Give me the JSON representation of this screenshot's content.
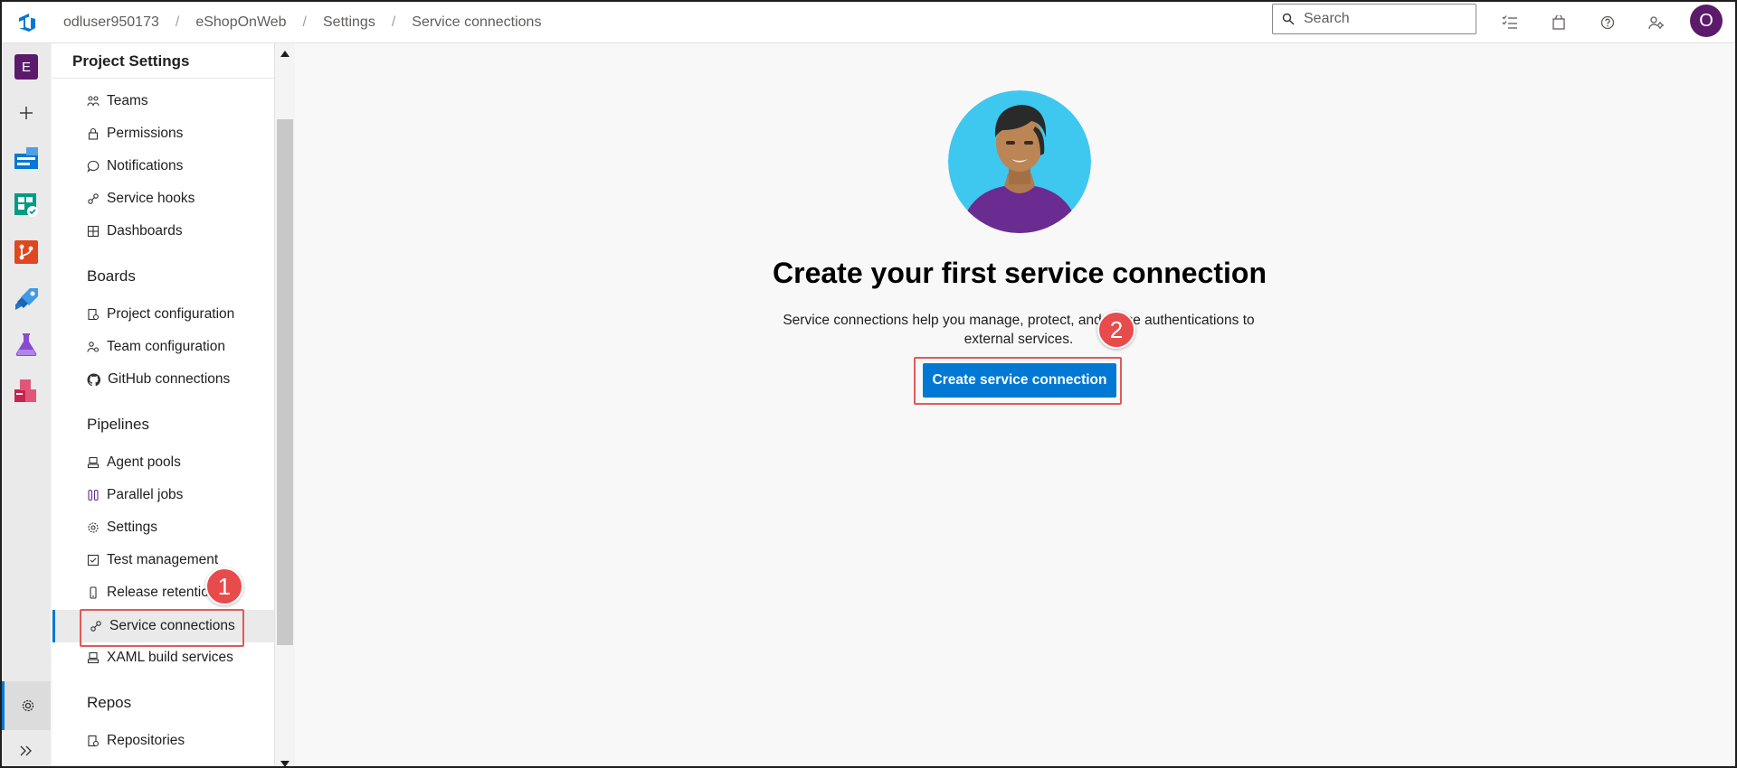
{
  "breadcrumb": [
    "odluser950173",
    "eShopOnWeb",
    "Settings",
    "Service connections"
  ],
  "search": {
    "placeholder": "Search"
  },
  "top_icons": [
    "task-list-icon",
    "shopping-bag-icon",
    "help-icon",
    "user-settings-icon"
  ],
  "user": {
    "initial": "O"
  },
  "rail": {
    "project_initial": "E",
    "items": [
      "add-icon",
      "overview-icon",
      "boards-icon",
      "repos-icon",
      "pipelines-icon",
      "test-plans-icon",
      "artifacts-icon"
    ]
  },
  "nav": {
    "title": "Project Settings",
    "general": [
      "Teams",
      "Permissions",
      "Notifications",
      "Service hooks",
      "Dashboards"
    ],
    "boards": {
      "label": "Boards",
      "items": [
        "Project configuration",
        "Team configuration",
        "GitHub connections"
      ]
    },
    "pipelines": {
      "label": "Pipelines",
      "items": [
        "Agent pools",
        "Parallel jobs",
        "Settings",
        "Test management",
        "Release retention",
        "Service connections",
        "XAML build services"
      ]
    },
    "repos": {
      "label": "Repos",
      "items": [
        "Repositories"
      ]
    },
    "selected": "Service connections"
  },
  "main": {
    "heading": "Create your first service connection",
    "description_line1": "Service connections help you manage, protect, and reuse authentications to",
    "description_line2": "external services.",
    "button": "Create service connection"
  },
  "annotations": {
    "step1": "1",
    "step2": "2"
  },
  "colors": {
    "accent": "#0078d4",
    "project": "#5c1a6b",
    "highlight": "#e05a5a",
    "badge": "#e84b4b"
  }
}
